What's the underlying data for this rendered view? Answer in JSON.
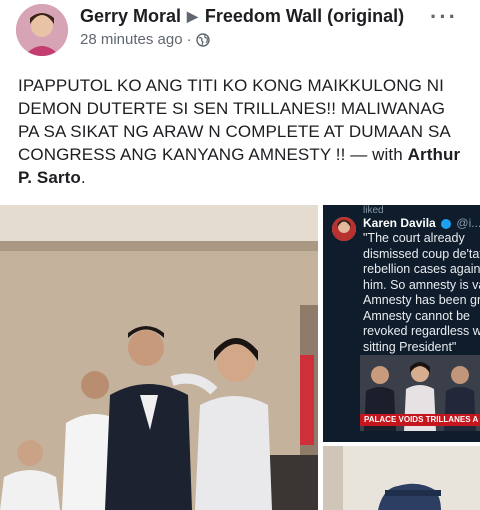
{
  "post": {
    "author": "Gerry Moral",
    "separator": "▶",
    "group": "Freedom Wall (original)",
    "time": "28 minutes ago",
    "dot": "·",
    "more": "···",
    "body": "IPAPPUTOL KO ANG TITI KO KONG MAIKKULONG NI DEMON DUTERTE SI SEN TRILLANES!! MALIWANAG PA SA SIKAT NG ARAW N COMPLETE AT DUMAAN SA CONGRESS ANG KANYANG AMNESTY !! — with",
    "tagged": "Arthur P. Sarto",
    "end": "."
  },
  "tweet": {
    "liked_label": "liked",
    "name": "Karen Davila",
    "handle": "@i...",
    "lines": [
      "\"The court already",
      "dismissed coup de'tat",
      "rebellion cases against",
      "him. So amnesty is valid.",
      "Amnesty has been granted.",
      "Amnesty cannot be",
      "revoked regardless who",
      "sitting President\""
    ],
    "caption": "PALACE VOIDS TRILLANES A"
  },
  "colors": {
    "text": "#1c1e21",
    "meta": "#606770",
    "tweet_bg": "#0f1c2c",
    "caption_red": "#c4161c"
  }
}
